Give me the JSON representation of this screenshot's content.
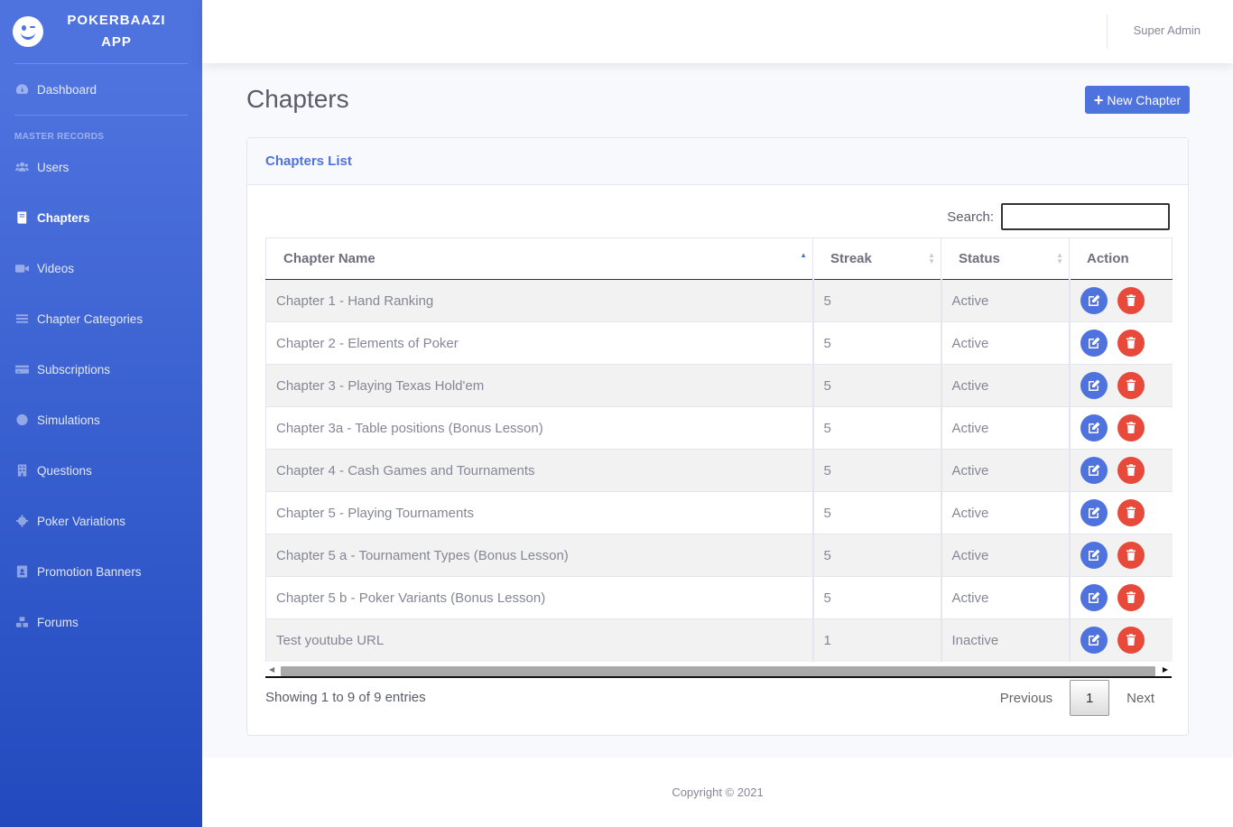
{
  "brand": {
    "name_line1": "POKERBAAZI",
    "name_line2": "APP",
    "logo_icon": "laughing-face-icon"
  },
  "sidebar": {
    "dashboard": {
      "label": "Dashboard",
      "icon": "tachometer-icon"
    },
    "section_heading": "MASTER RECORDS",
    "items": [
      {
        "label": "Users",
        "icon": "users-icon",
        "active": false
      },
      {
        "label": "Chapters",
        "icon": "book-icon",
        "active": true
      },
      {
        "label": "Videos",
        "icon": "video-icon",
        "active": false
      },
      {
        "label": "Chapter Categories",
        "icon": "list-icon",
        "active": false
      },
      {
        "label": "Subscriptions",
        "icon": "credit-card-icon",
        "active": false
      },
      {
        "label": "Simulations",
        "icon": "basketball-icon",
        "active": false
      },
      {
        "label": "Questions",
        "icon": "building-icon",
        "active": false
      },
      {
        "label": "Poker Variations",
        "icon": "cog-icon",
        "active": false
      },
      {
        "label": "Promotion Banners",
        "icon": "id-badge-icon",
        "active": false
      },
      {
        "label": "Forums",
        "icon": "cubes-icon",
        "active": false
      }
    ]
  },
  "topbar": {
    "user_name": "Super Admin"
  },
  "page": {
    "title": "Chapters",
    "new_button_label": "New Chapter"
  },
  "card": {
    "title": "Chapters List",
    "search_label": "Search:",
    "search_value": "",
    "columns": [
      "Chapter Name",
      "Streak",
      "Status",
      "Action"
    ],
    "sorted_column": "Chapter Name",
    "rows": [
      {
        "name": "Chapter 1 - Hand Ranking",
        "streak": "5",
        "status": "Active"
      },
      {
        "name": "Chapter 2 - Elements of Poker",
        "streak": "5",
        "status": "Active"
      },
      {
        "name": "Chapter 3 - Playing Texas Hold'em",
        "streak": "5",
        "status": "Active"
      },
      {
        "name": "Chapter 3a - Table positions (Bonus Lesson)",
        "streak": "5",
        "status": "Active"
      },
      {
        "name": "Chapter 4 - Cash Games and Tournaments",
        "streak": "5",
        "status": "Active"
      },
      {
        "name": "Chapter 5 - Playing Tournaments",
        "streak": "5",
        "status": "Active"
      },
      {
        "name": "Chapter 5 a - Tournament Types (Bonus Lesson)",
        "streak": "5",
        "status": "Active"
      },
      {
        "name": "Chapter 5 b - Poker Variants (Bonus Lesson)",
        "streak": "5",
        "status": "Active"
      },
      {
        "name": "Test youtube URL",
        "streak": "1",
        "status": "Inactive"
      }
    ],
    "info_text": "Showing 1 to 9 of 9 entries",
    "pagination": {
      "previous": "Previous",
      "current_page": "1",
      "next": "Next"
    }
  },
  "footer": {
    "copyright": "Copyright © 2021"
  },
  "colors": {
    "primary": "#4e73df",
    "danger": "#e74a3b",
    "sidebar_dark": "#224abe"
  }
}
